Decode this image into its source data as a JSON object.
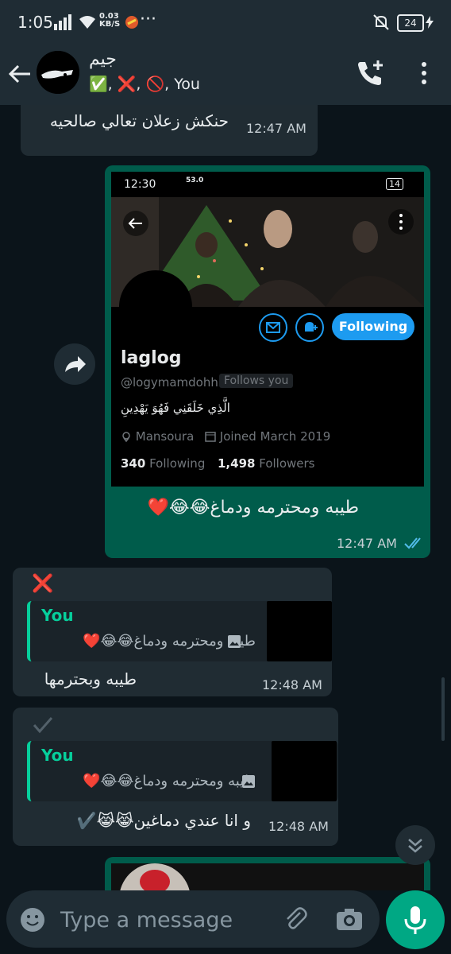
{
  "status_bar": {
    "time": "1:05",
    "net_speed": "0.03",
    "net_unit": "KB/S",
    "more": "···",
    "battery": "24"
  },
  "header": {
    "title": "جيم",
    "subtitle": "✅, ❌, 🚫, You"
  },
  "messages": {
    "m1": {
      "text": "حنكش زعلان تعالي صالحيه",
      "time": "12:47 AM"
    },
    "m2": {
      "caption": "طيبه ومحترمه ودماغ😂😂❤️",
      "time": "12:47 AM",
      "screenshot": {
        "time": "12:30",
        "net": "53.0",
        "battery": "14",
        "follow_label": "Following",
        "name": "laglog",
        "handle": "@logymamdohh",
        "follows_you": "Follows you",
        "bio": "الَّذِي خَلَقَنِي فَهُوَ يَهْدِينِ",
        "location": "Mansoura",
        "joined": "Joined March 2019",
        "following_count": "340",
        "following_label": "Following",
        "followers_count": "1,498",
        "followers_label": "Followers"
      }
    },
    "m3": {
      "reaction": "❌",
      "quote_name": "You",
      "quote_text": "طيبه ومحترمه ودماغ😂😂❤️",
      "text": "طيبه وبحترمها",
      "time": "12:48 AM"
    },
    "m4": {
      "quote_name": "You",
      "quote_text": "طيبه ومحترمه ودماغ😂😂❤️",
      "text": "و انا عندي دماغين😹😹✔️",
      "time": "12:48 AM"
    }
  },
  "input": {
    "placeholder": "Type a message"
  },
  "colors": {
    "header": "#1f2c34",
    "outgoing": "#005c4b",
    "incoming": "#202c33",
    "accent": "#00a884",
    "twitter_blue": "#1d9bf0"
  }
}
